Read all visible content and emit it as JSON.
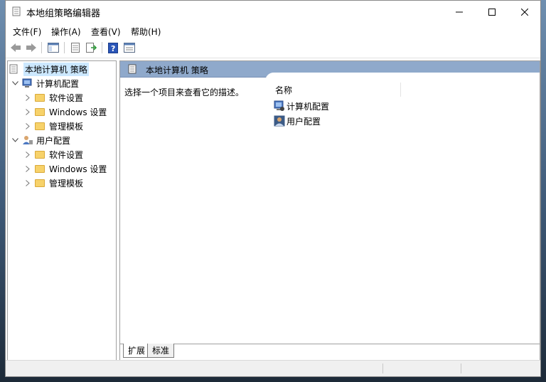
{
  "window": {
    "title": "本地组策略编辑器"
  },
  "menu": [
    "文件(F)",
    "操作(A)",
    "查看(V)",
    "帮助(H)"
  ],
  "tree": {
    "root": "本地计算机 策略",
    "computer": {
      "label": "计算机配置",
      "children": [
        "软件设置",
        "Windows 设置",
        "管理模板"
      ]
    },
    "user": {
      "label": "用户配置",
      "children": [
        "软件设置",
        "Windows 设置",
        "管理模板"
      ]
    }
  },
  "right": {
    "header": "本地计算机 策略",
    "description": "选择一个项目来查看它的描述。",
    "list_header": "名称",
    "items": [
      "计算机配置",
      "用户配置"
    ]
  },
  "tabs": [
    "扩展",
    "标准"
  ],
  "colors": {
    "header_bg": "#8fa9cb",
    "selection": "#cce8ff",
    "folder": "#f7d26a"
  }
}
